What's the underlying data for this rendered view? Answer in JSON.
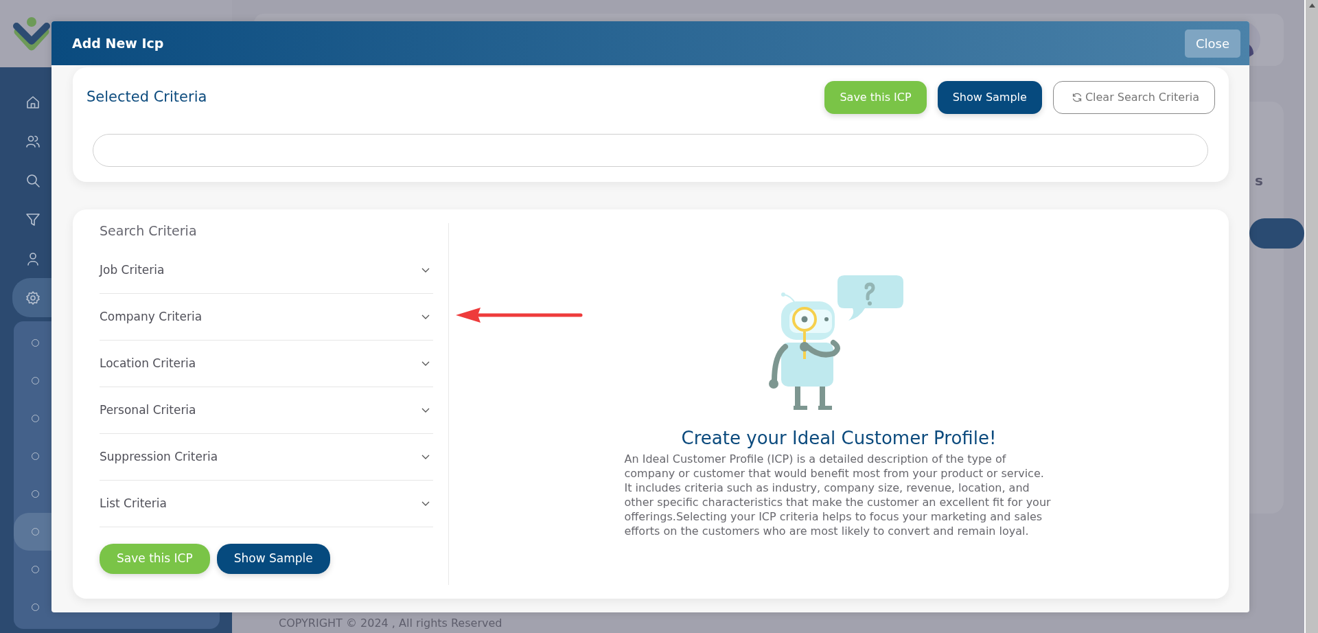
{
  "background": {
    "sidebar": {
      "items": [
        {
          "kind": "home",
          "selected": false
        },
        {
          "kind": "users",
          "selected": false
        },
        {
          "kind": "search",
          "selected": false
        },
        {
          "kind": "filter",
          "selected": false
        },
        {
          "kind": "user",
          "selected": false
        },
        {
          "kind": "settings",
          "selected": true
        }
      ],
      "subitems": [
        {
          "selected": false
        },
        {
          "selected": false
        },
        {
          "selected": false
        },
        {
          "selected": false
        },
        {
          "selected": false
        },
        {
          "selected": true
        },
        {
          "selected": false
        },
        {
          "selected": false
        }
      ]
    },
    "fragment": "s",
    "footer": "COPYRIGHT © 2024 , All rights Reserved"
  },
  "modal": {
    "title": "Add New Icp",
    "close": "Close",
    "selected_criteria": {
      "title": "Selected Criteria",
      "buttons": [
        {
          "kind": "save",
          "label": "Save this ICP"
        },
        {
          "kind": "sample",
          "label": "Show Sample"
        },
        {
          "kind": "clear",
          "label": "Clear Search Criteria"
        }
      ]
    },
    "search_criteria": {
      "title": "Search Criteria",
      "items": [
        {
          "label": "Job Criteria",
          "expanded": false
        },
        {
          "label": "Company Criteria",
          "expanded": false
        },
        {
          "label": "Location Criteria",
          "expanded": false
        },
        {
          "label": "Personal Criteria",
          "expanded": false
        },
        {
          "label": "Suppression Criteria",
          "expanded": false
        },
        {
          "label": "List Criteria",
          "expanded": false
        }
      ],
      "buttons": [
        {
          "kind": "save",
          "label": "Save this ICP"
        },
        {
          "kind": "sample",
          "label": "Show Sample"
        }
      ]
    },
    "intro": {
      "heading": "Create your Ideal Customer Profile!",
      "body": "An Ideal Customer Profile (ICP) is a detailed description of the type of company or customer that would benefit most from your product or service. It includes criteria such as industry, company size, revenue, location, and other specific characteristics that make the customer an excellent fit for your offerings.Selecting your ICP criteria helps to focus your marketing and sales efforts on the customers who are most likely to convert and remain loyal."
    }
  }
}
